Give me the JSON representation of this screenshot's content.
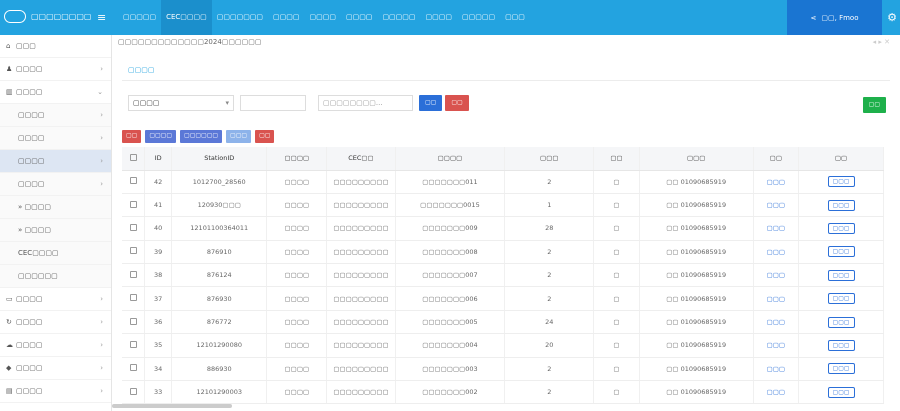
{
  "app": {
    "title": "▢▢▢▢▢▢▢▢"
  },
  "nav": [
    "▢▢▢▢▢",
    "CEC▢▢▢▢",
    "▢▢▢▢▢▢▢",
    "▢▢▢▢",
    "▢▢▢▢",
    "▢▢▢▢",
    "▢▢▢▢▢",
    "▢▢▢▢",
    "▢▢▢▢▢",
    "▢▢▢"
  ],
  "user": {
    "name": "▢▢, Fmoo"
  },
  "sidebar": [
    {
      "label": "▢▢▢",
      "icon": "home-icon",
      "chev": ""
    },
    {
      "label": "▢▢▢▢",
      "icon": "user-icon",
      "chev": "›"
    },
    {
      "label": "▢▢▢▢",
      "icon": "bank-icon",
      "chev": "⌄"
    },
    {
      "label": "▢▢▢▢",
      "icon": "",
      "chev": "›",
      "sub": true
    },
    {
      "label": "▢▢▢▢",
      "icon": "",
      "chev": "›",
      "sub": true
    },
    {
      "label": "▢▢▢▢",
      "icon": "",
      "chev": "›",
      "sub": true,
      "active": true
    },
    {
      "label": "▢▢▢▢",
      "icon": "",
      "chev": "›",
      "sub": true
    },
    {
      "label": "» ▢▢▢▢",
      "icon": "",
      "chev": "",
      "sub": true
    },
    {
      "label": "» ▢▢▢▢",
      "icon": "",
      "chev": "",
      "sub": true
    },
    {
      "label": "CEC▢▢▢▢",
      "icon": "",
      "chev": "",
      "sub": true
    },
    {
      "label": "▢▢▢▢▢▢",
      "icon": "",
      "chev": "",
      "sub": true
    },
    {
      "label": "▢▢▢▢",
      "icon": "monitor-icon",
      "chev": "›"
    },
    {
      "label": "▢▢▢▢",
      "icon": "refresh-icon",
      "chev": "›"
    },
    {
      "label": "▢▢▢▢",
      "icon": "cloud-icon",
      "chev": "›"
    },
    {
      "label": "▢▢▢▢",
      "icon": "tag-icon",
      "chev": "›"
    },
    {
      "label": "▢▢▢▢",
      "icon": "image-icon",
      "chev": "›"
    }
  ],
  "breadcrumb": "▢▢▢▢▢▢▢▢▢▢▢▢▢2024▢▢▢▢▢▢",
  "tab": "▢▢▢▢",
  "filter": {
    "select_value": "▢▢▢▢",
    "input1_placeholder": "",
    "input2_placeholder": "▢▢▢▢▢▢▢▢...",
    "search": "▢▢",
    "reset": "▢▢"
  },
  "export": "▢▢",
  "actions": [
    "▢▢",
    "▢▢▢▢",
    "▢▢▢▢▢▢",
    "▢▢▢",
    "▢▢"
  ],
  "columns": [
    "ID",
    "StationID",
    "▢▢▢▢",
    "CEC▢▢",
    "▢▢▢▢",
    "▢▢▢",
    "▢▢",
    "▢▢▢",
    "▢▢",
    "▢▢"
  ],
  "rows": [
    {
      "id": "42",
      "station": "1012700_28560",
      "platform": "▢▢▢▢",
      "cec": "▢▢▢▢▢▢▢▢▢",
      "name": "▢▢▢▢▢▢▢011",
      "piles": "2",
      "status2": "▢",
      "owner": "▢▢ 01090685919",
      "state": "▢▢▢",
      "more": "▢▢▢"
    },
    {
      "id": "41",
      "station": "120930▢▢▢",
      "platform": "▢▢▢▢",
      "cec": "▢▢▢▢▢▢▢▢▢",
      "name": "▢▢▢▢▢▢▢0015",
      "piles": "1",
      "status2": "▢",
      "owner": "▢▢ 01090685919",
      "state": "▢▢▢",
      "more": "▢▢▢"
    },
    {
      "id": "40",
      "station": "12101100364011",
      "platform": "▢▢▢▢",
      "cec": "▢▢▢▢▢▢▢▢▢",
      "name": "▢▢▢▢▢▢▢009",
      "piles": "28",
      "status2": "▢",
      "owner": "▢▢ 01090685919",
      "state": "▢▢▢",
      "more": "▢▢▢"
    },
    {
      "id": "39",
      "station": "876910",
      "platform": "▢▢▢▢",
      "cec": "▢▢▢▢▢▢▢▢▢",
      "name": "▢▢▢▢▢▢▢008",
      "piles": "2",
      "status2": "▢",
      "owner": "▢▢ 01090685919",
      "state": "▢▢▢",
      "more": "▢▢▢"
    },
    {
      "id": "38",
      "station": "876124",
      "platform": "▢▢▢▢",
      "cec": "▢▢▢▢▢▢▢▢▢",
      "name": "▢▢▢▢▢▢▢007",
      "piles": "2",
      "status2": "▢",
      "owner": "▢▢ 01090685919",
      "state": "▢▢▢",
      "more": "▢▢▢"
    },
    {
      "id": "37",
      "station": "876930",
      "platform": "▢▢▢▢",
      "cec": "▢▢▢▢▢▢▢▢▢",
      "name": "▢▢▢▢▢▢▢006",
      "piles": "2",
      "status2": "▢",
      "owner": "▢▢ 01090685919",
      "state": "▢▢▢",
      "more": "▢▢▢"
    },
    {
      "id": "36",
      "station": "876772",
      "platform": "▢▢▢▢",
      "cec": "▢▢▢▢▢▢▢▢▢",
      "name": "▢▢▢▢▢▢▢005",
      "piles": "24",
      "status2": "▢",
      "owner": "▢▢ 01090685919",
      "state": "▢▢▢",
      "more": "▢▢▢"
    },
    {
      "id": "35",
      "station": "12101290080",
      "platform": "▢▢▢▢",
      "cec": "▢▢▢▢▢▢▢▢▢",
      "name": "▢▢▢▢▢▢▢004",
      "piles": "20",
      "status2": "▢",
      "owner": "▢▢ 01090685919",
      "state": "▢▢▢",
      "more": "▢▢▢"
    },
    {
      "id": "34",
      "station": "886930",
      "platform": "▢▢▢▢",
      "cec": "▢▢▢▢▢▢▢▢▢",
      "name": "▢▢▢▢▢▢▢003",
      "piles": "2",
      "status2": "▢",
      "owner": "▢▢ 01090685919",
      "state": "▢▢▢",
      "more": "▢▢▢"
    },
    {
      "id": "33",
      "station": "12101290003",
      "platform": "▢▢▢▢",
      "cec": "▢▢▢▢▢▢▢▢▢",
      "name": "▢▢▢▢▢▢▢002",
      "piles": "2",
      "status2": "▢",
      "owner": "▢▢ 01090685919",
      "state": "▢▢▢",
      "more": "▢▢▢"
    }
  ]
}
